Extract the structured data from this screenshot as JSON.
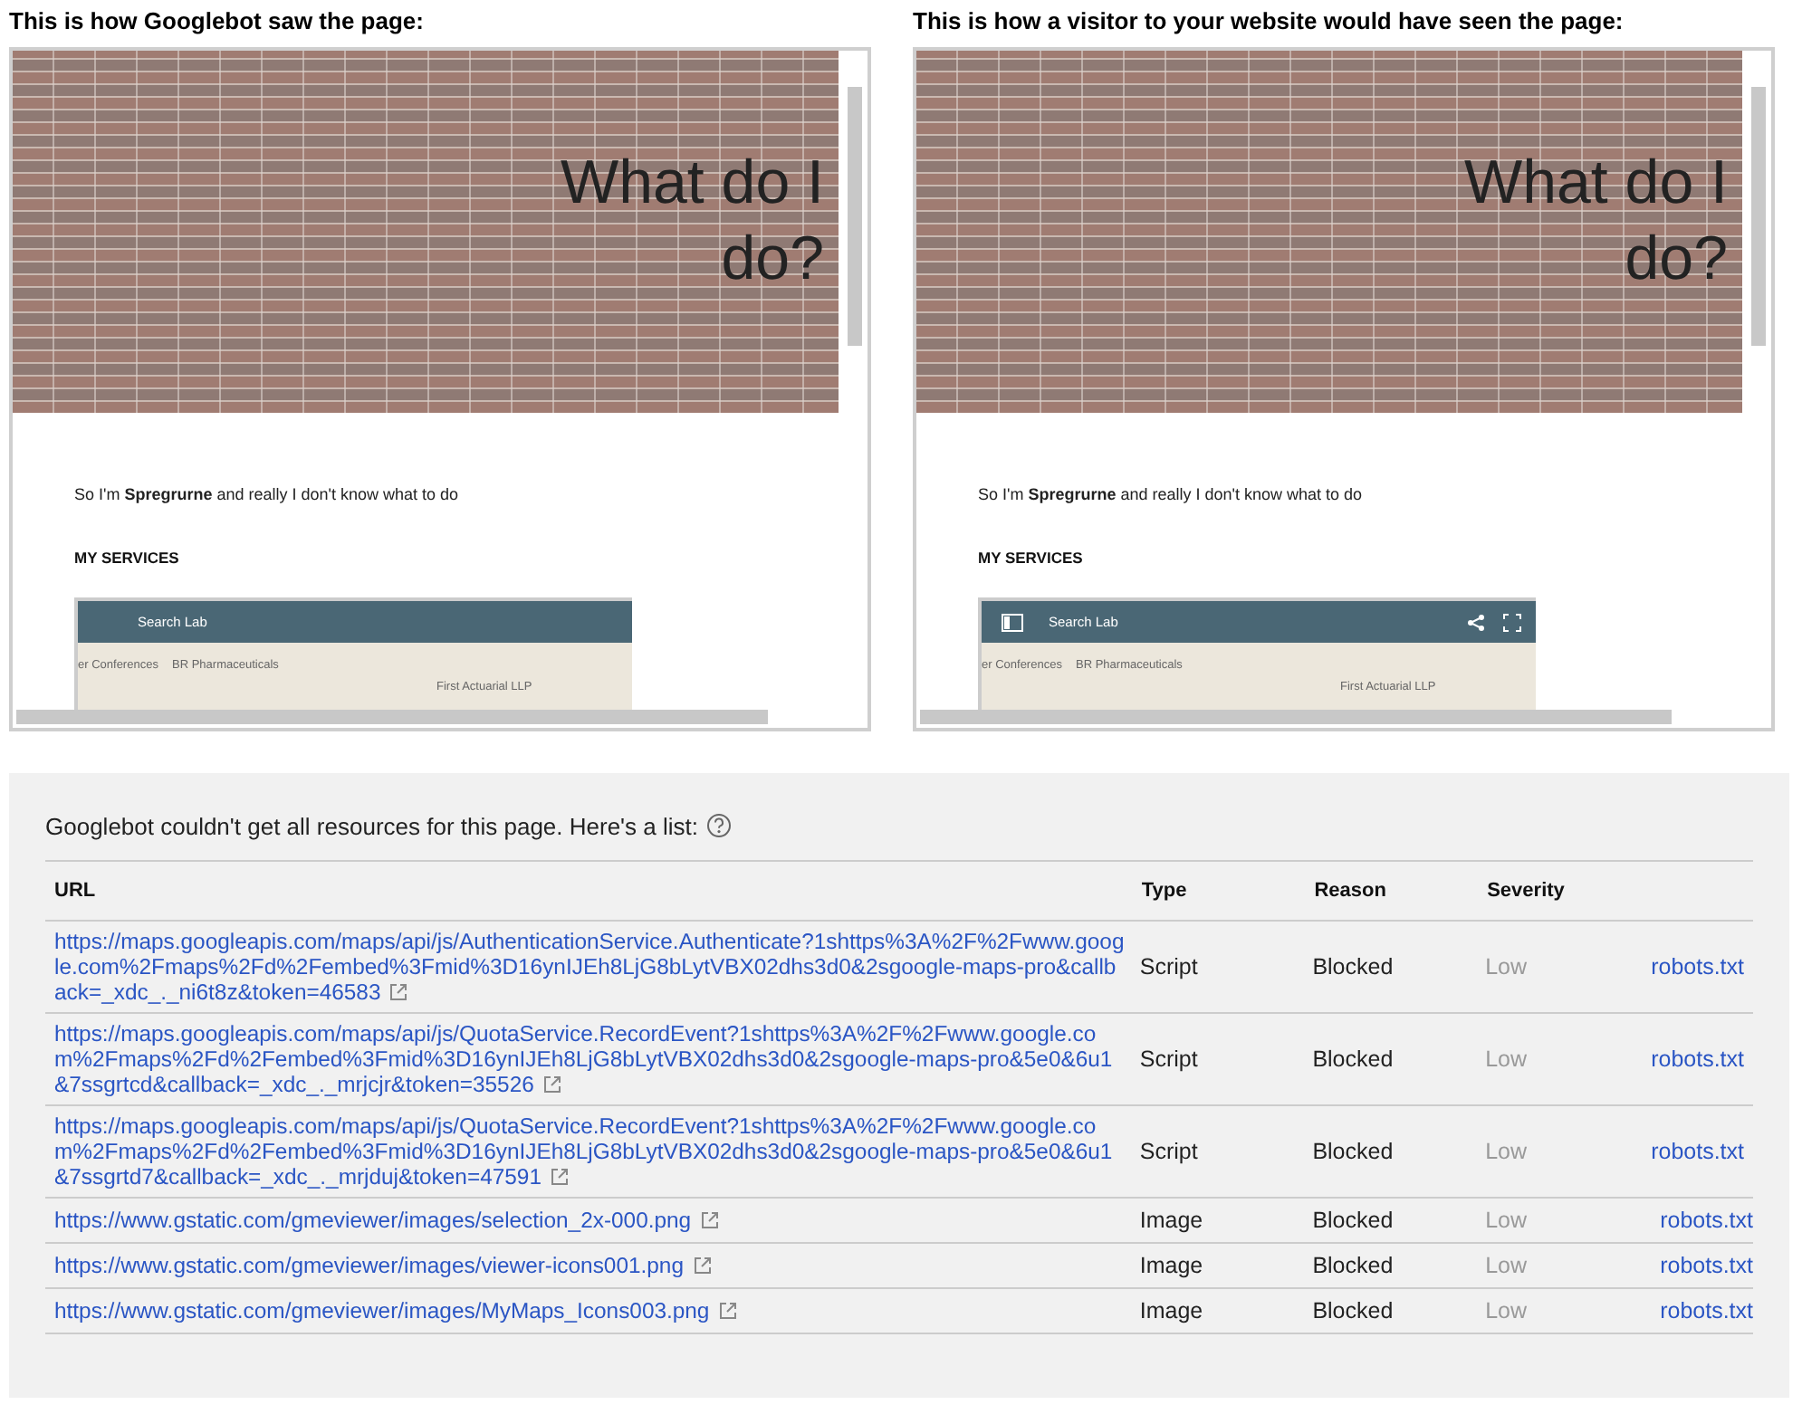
{
  "panels": [
    {
      "title": "This is how Googlebot saw the page:",
      "hero_heading": "What do I do?",
      "intro": "So I'm **Spregrurne** and really I don't know what to do",
      "section": "MY SERVICES",
      "map": {
        "title": "Search Lab",
        "toolbar_icons": false,
        "labels": [
          "er Conferences",
          "BR Pharmaceuticals",
          "First Actuarial LLP"
        ]
      }
    },
    {
      "title": "This is how a visitor to your website would have seen the page:",
      "hero_heading": "What do I do?",
      "intro": "So I'm **Spregrurne** and really I don't know what to do",
      "section": "MY SERVICES",
      "map": {
        "title": "Search Lab",
        "toolbar_icons": true,
        "labels": [
          "er Conferences",
          "BR Pharmaceuticals",
          "First Actuarial LLP"
        ]
      }
    }
  ],
  "resources": {
    "heading": "Googlebot couldn't get all resources for this page. Here's a list:",
    "columns": [
      "URL",
      "Type",
      "Reason",
      "Severity"
    ],
    "rows": [
      {
        "url": "https://maps.googleapis.com/maps/api/js/AuthenticationService.Authenticate?1shttps%3A%2F%2Fwww.google.com%2Fmaps%2Fd%2Fembed%3Fmid%3D16ynIJEh8LjG8bLytVBX02dhs3d0&2sgoogle-maps-pro&callback=_xdc_._ni6t8z&token=46583",
        "type": "Script",
        "reason": "Blocked",
        "severity": "Low",
        "link": "robots.txt"
      },
      {
        "url": "https://maps.googleapis.com/maps/api/js/QuotaService.RecordEvent?1shttps%3A%2F%2Fwww.google.com%2Fmaps%2Fd%2Fembed%3Fmid%3D16ynIJEh8LjG8bLytVBX02dhs3d0&2sgoogle-maps-pro&5e0&6u1&7ssgrtcd&callback=_xdc_._mrjcjr&token=35526",
        "type": "Script",
        "reason": "Blocked",
        "severity": "Low",
        "link": "robots.txt"
      },
      {
        "url": "https://maps.googleapis.com/maps/api/js/QuotaService.RecordEvent?1shttps%3A%2F%2Fwww.google.com%2Fmaps%2Fd%2Fembed%3Fmid%3D16ynIJEh8LjG8bLytVBX02dhs3d0&2sgoogle-maps-pro&5e0&6u1&7ssgrtd7&callback=_xdc_._mrjduj&token=47591",
        "type": "Script",
        "reason": "Blocked",
        "severity": "Low",
        "link": "robots.txt"
      },
      {
        "url": "https://www.gstatic.com/gmeviewer/images/selection_2x-000.png",
        "type": "Image",
        "reason": "Blocked",
        "severity": "Low",
        "link": "robots.txt"
      },
      {
        "url": "https://www.gstatic.com/gmeviewer/images/viewer-icons001.png",
        "type": "Image",
        "reason": "Blocked",
        "severity": "Low",
        "link": "robots.txt"
      },
      {
        "url": "https://www.gstatic.com/gmeviewer/images/MyMaps_Icons003.png",
        "type": "Image",
        "reason": "Blocked",
        "severity": "Low",
        "link": "robots.txt"
      }
    ]
  }
}
